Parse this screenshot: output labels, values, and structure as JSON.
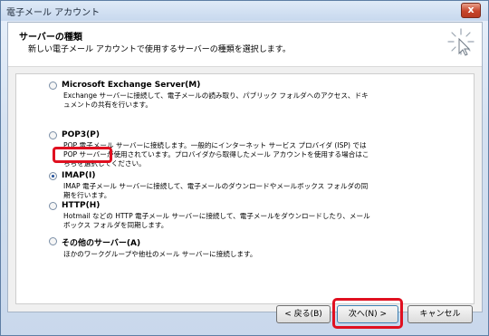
{
  "window": {
    "title": "電子メール アカウント",
    "close_label": "x"
  },
  "header": {
    "title": "サーバーの種類",
    "subtitle": "新しい電子メール アカウントで使用するサーバーの種類を選択します。"
  },
  "options": [
    {
      "label": "Microsoft Exchange Server(M)",
      "desc": "Exchange サーバーに接続して、電子メールの読み取り、パブリック フォルダへのアクセス、ドキュメントの共有を行います。",
      "selected": false
    },
    {
      "label": "POP3(P)",
      "desc": "POP 電子メール サーバーに接続します。一般的にインターネット サービス プロバイダ (ISP) では POP サーバーが使用されています。プロバイダから取得したメール アカウントを使用する場合はこちらを選択してください。",
      "selected": false
    },
    {
      "label": "IMAP(I)",
      "desc": "IMAP 電子メール サーバーに接続して、電子メールのダウンロードやメールボックス フォルダの同期を行います。",
      "selected": true
    },
    {
      "label": "HTTP(H)",
      "desc": "Hotmail などの HTTP 電子メール サーバーに接続して、電子メールをダウンロードしたり、メールボックス フォルダを同期します。",
      "selected": false
    },
    {
      "label": "その他のサーバー(A)",
      "desc": "ほかのワークグループや他社のメール サーバーに接続します。",
      "selected": false
    }
  ],
  "buttons": {
    "back": "< 戻る(B)",
    "next": "次へ(N) >",
    "cancel": "キャンセル"
  },
  "colors": {
    "highlight": "#e01020",
    "selected_radio": "#1f4f9c"
  }
}
